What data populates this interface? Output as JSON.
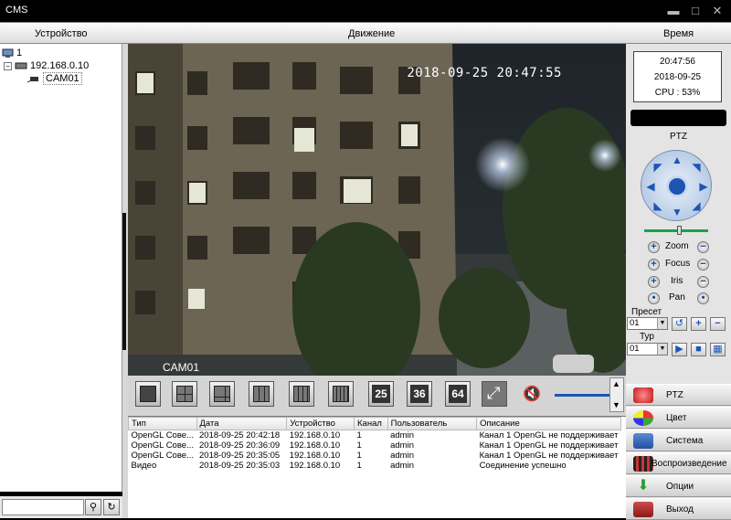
{
  "window": {
    "title": "CMS",
    "minimize": "▬",
    "maximize": "□",
    "close": "✕"
  },
  "menu": {
    "device": "Устройство",
    "motion": "Движение",
    "time": "Время"
  },
  "tree": {
    "root": "1",
    "host": "192.168.0.10",
    "camera": "CAM01"
  },
  "video": {
    "timestamp": "2018-09-25 20:47:55",
    "camera_label": "CAM01"
  },
  "layouts": {
    "n25": "25",
    "n36": "36",
    "n64": "64"
  },
  "log": {
    "headers": [
      "Тип",
      "Дата",
      "Устройство",
      "Канал",
      "Пользователь",
      "Описание"
    ],
    "rows": [
      [
        "OpenGL Cове...",
        "2018-09-25 20:42:18",
        "192.168.0.10",
        "1",
        "admin",
        "Канал 1 OpenGL не поддерживает"
      ],
      [
        "OpenGL Cове...",
        "2018-09-25 20:36:09",
        "192.168.0.10",
        "1",
        "admin",
        "Канал 1 OpenGL не поддерживает"
      ],
      [
        "OpenGL Cове...",
        "2018-09-25 20:35:05",
        "192.168.0.10",
        "1",
        "admin",
        "Канал 1 OpenGL не поддерживает"
      ],
      [
        "Видео",
        "2018-09-25 20:35:03",
        "192.168.0.10",
        "1",
        "admin",
        "Соединение успешно"
      ]
    ]
  },
  "clock": {
    "time": "20:47:56",
    "date": "2018-09-25",
    "cpu": "CPU : 53%"
  },
  "ptz": {
    "title": "PTZ",
    "zoom": "Zoom",
    "focus": "Focus",
    "iris": "Iris",
    "pan": "Pan",
    "preset_label": "Пресет",
    "preset_value": "01",
    "tour_label": "Тур",
    "tour_value": "01"
  },
  "side_menu": {
    "ptz": "PTZ",
    "color": "Цвет",
    "system": "Система",
    "playback": "Воспроизведение",
    "options": "Опции",
    "exit": "Выход"
  },
  "colors": {
    "accent": "#1d55b5",
    "titlebar": "#000000"
  }
}
